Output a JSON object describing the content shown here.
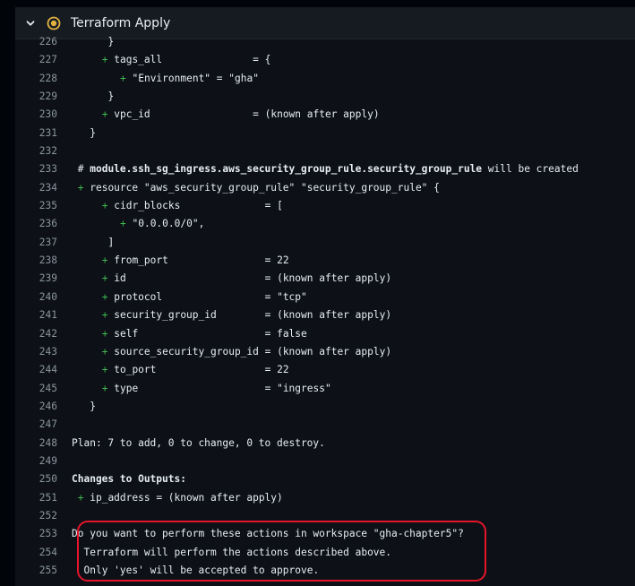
{
  "step": {
    "title": "Terraform Apply",
    "icon": "chevron-down-icon",
    "status_icon": "in-progress-icon",
    "status_color": "#e3b341"
  },
  "log_lines": [
    {
      "n": "226",
      "indent": 6,
      "plus": false,
      "text": "}",
      "bold": false
    },
    {
      "n": "227",
      "indent": 5,
      "plus": true,
      "text": "tags_all               = {",
      "bold": false
    },
    {
      "n": "228",
      "indent": 8,
      "plus": true,
      "text": "\"Environment\" = \"gha\"",
      "bold": false
    },
    {
      "n": "229",
      "indent": 6,
      "plus": false,
      "text": "}",
      "bold": false
    },
    {
      "n": "230",
      "indent": 5,
      "plus": true,
      "text": "vpc_id                 = (known after apply)",
      "bold": false
    },
    {
      "n": "231",
      "indent": 3,
      "plus": false,
      "text": "}",
      "bold": false
    },
    {
      "n": "232",
      "indent": 0,
      "plus": false,
      "text": "",
      "bold": false
    },
    {
      "n": "233",
      "indent": 1,
      "plus": false,
      "text": "# ",
      "bold_part": "module.ssh_sg_ingress.aws_security_group_rule.security_group_rule",
      "rest": " will be created",
      "bold": false
    },
    {
      "n": "234",
      "indent": 1,
      "plus": true,
      "text": "resource \"aws_security_group_rule\" \"security_group_rule\" {",
      "bold": false
    },
    {
      "n": "235",
      "indent": 5,
      "plus": true,
      "text": "cidr_blocks              = [",
      "bold": false
    },
    {
      "n": "236",
      "indent": 8,
      "plus": true,
      "text": "\"0.0.0.0/0\",",
      "bold": false
    },
    {
      "n": "237",
      "indent": 6,
      "plus": false,
      "text": "]",
      "bold": false
    },
    {
      "n": "238",
      "indent": 5,
      "plus": true,
      "text": "from_port                = 22",
      "bold": false
    },
    {
      "n": "239",
      "indent": 5,
      "plus": true,
      "text": "id                       = (known after apply)",
      "bold": false
    },
    {
      "n": "240",
      "indent": 5,
      "plus": true,
      "text": "protocol                 = \"tcp\"",
      "bold": false
    },
    {
      "n": "241",
      "indent": 5,
      "plus": true,
      "text": "security_group_id        = (known after apply)",
      "bold": false
    },
    {
      "n": "242",
      "indent": 5,
      "plus": true,
      "text": "self                     = false",
      "bold": false
    },
    {
      "n": "243",
      "indent": 5,
      "plus": true,
      "text": "source_security_group_id = (known after apply)",
      "bold": false
    },
    {
      "n": "244",
      "indent": 5,
      "plus": true,
      "text": "to_port                  = 22",
      "bold": false
    },
    {
      "n": "245",
      "indent": 5,
      "plus": true,
      "text": "type                     = \"ingress\"",
      "bold": false
    },
    {
      "n": "246",
      "indent": 3,
      "plus": false,
      "text": "}",
      "bold": false
    },
    {
      "n": "247",
      "indent": 0,
      "plus": false,
      "text": "",
      "bold": false
    },
    {
      "n": "248",
      "indent": 0,
      "plus": false,
      "text": "Plan: 7 to add, 0 to change, 0 to destroy.",
      "bold": false
    },
    {
      "n": "249",
      "indent": 0,
      "plus": false,
      "text": "",
      "bold": false
    },
    {
      "n": "250",
      "indent": 0,
      "plus": false,
      "text": "Changes to Outputs:",
      "bold": true
    },
    {
      "n": "251",
      "indent": 1,
      "plus": true,
      "text": "ip_address = (known after apply)",
      "bold": false
    },
    {
      "n": "252",
      "indent": 0,
      "plus": false,
      "text": "",
      "bold": false
    },
    {
      "n": "253",
      "indent": 0,
      "plus": false,
      "text": "Do you want to perform these actions in workspace \"gha-chapter5\"?",
      "bold": false
    },
    {
      "n": "254",
      "indent": 2,
      "plus": false,
      "text": "Terraform will perform the actions described above.",
      "bold": false
    },
    {
      "n": "255",
      "indent": 2,
      "plus": false,
      "text": "Only 'yes' will be accepted to approve.",
      "bold": false
    }
  ],
  "colors": {
    "background": "#0d1117",
    "line_number": "#8b949e",
    "plus": "#3fb950",
    "highlight_border": "#e5142b"
  }
}
